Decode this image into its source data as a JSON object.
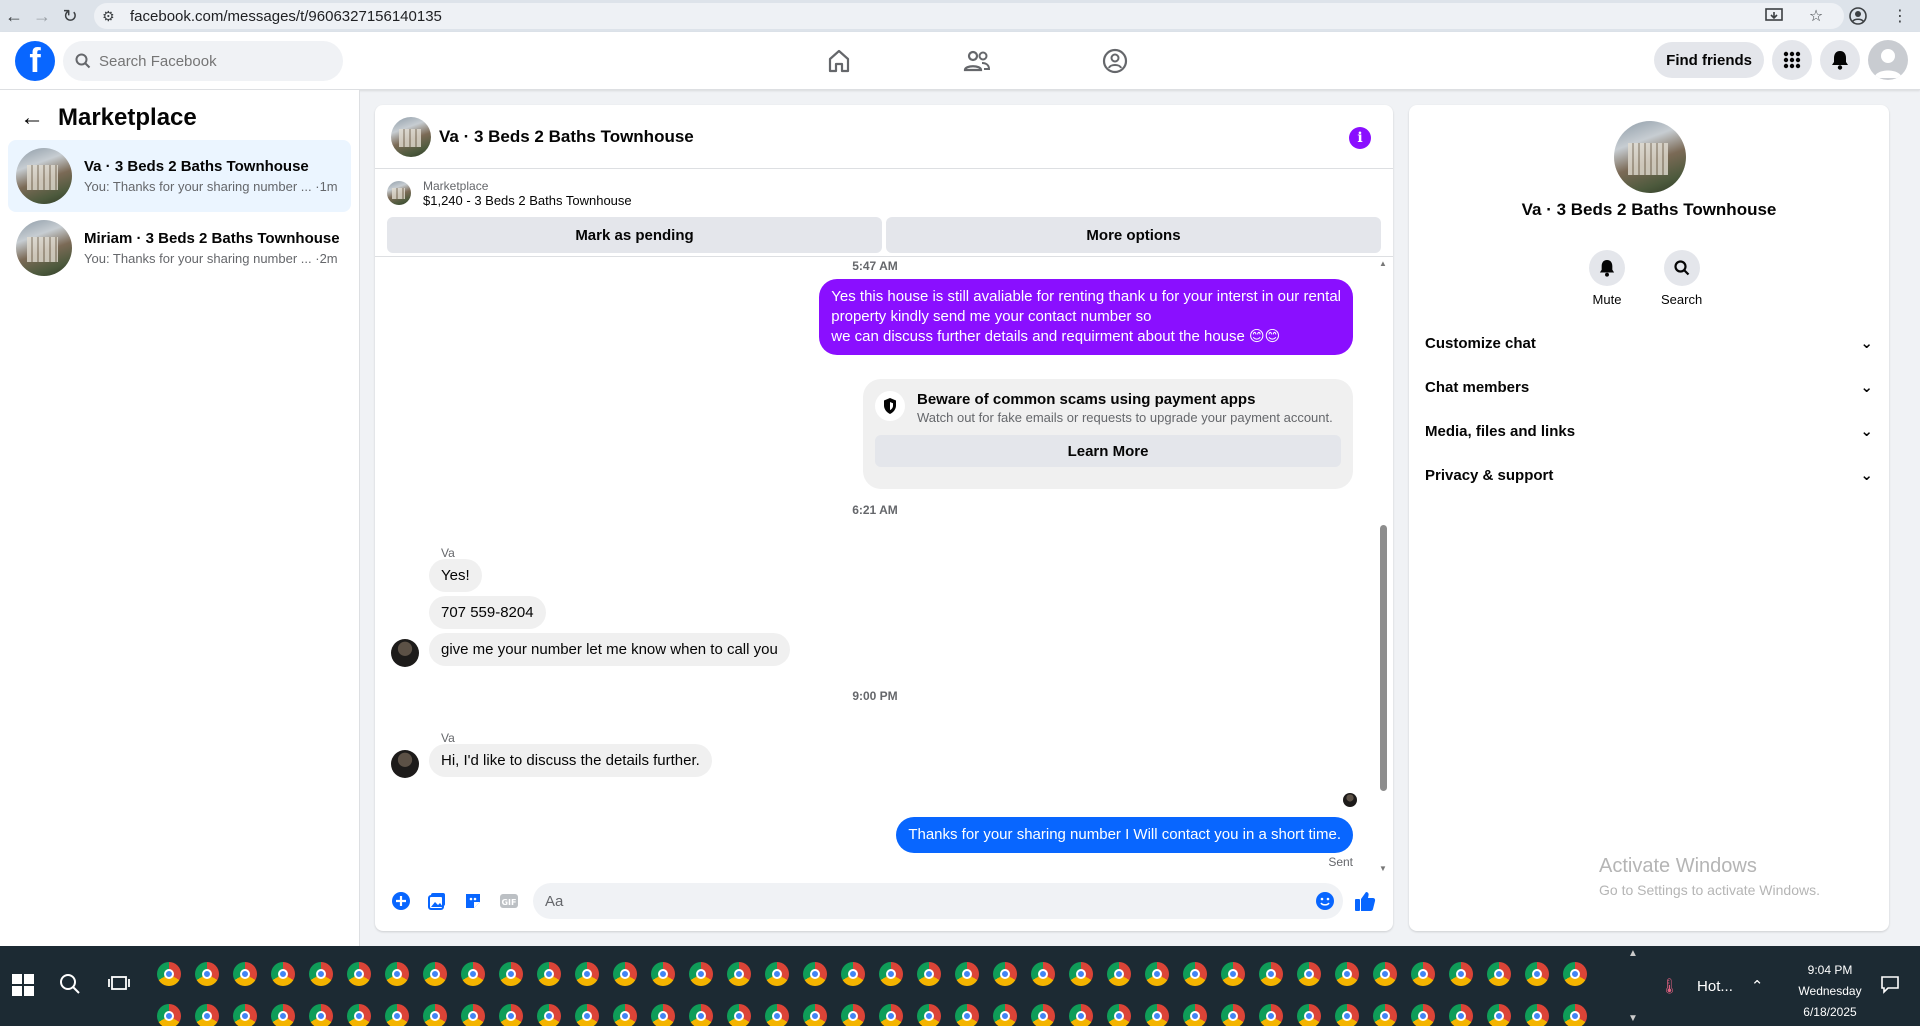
{
  "browser": {
    "url": "facebook.com/messages/t/9606327156140135"
  },
  "topbar": {
    "logo_letter": "f",
    "search_placeholder": "Search Facebook",
    "find_friends_label": "Find friends"
  },
  "sidebar": {
    "title": "Marketplace",
    "chats": [
      {
        "name": "Va · 3 Beds 2 Baths Townhouse",
        "snippet": "You: Thanks for your sharing number ... ·1m"
      },
      {
        "name": "Miriam · 3 Beds 2 Baths Townhouse",
        "snippet": "You: Thanks for your sharing number ... ·2m"
      }
    ]
  },
  "conversation": {
    "title": "Va · 3 Beds 2 Baths Townhouse",
    "info_icon": "i",
    "listing": {
      "label": "Marketplace",
      "price_title": "$1,240 - 3 Beds 2 Baths Townhouse"
    },
    "actions": [
      "Mark as pending",
      "More options"
    ],
    "messages": {
      "time_0": "5:47 AM",
      "out_1_line1": "Yes this house is still avaliable for renting thank u for your interst in our rental",
      "out_1_line2": "property kindly send me your contact number so",
      "out_1_line3": "we can discuss further details and requirment about the house 😊😊",
      "warning_title": "Beware of common scams using payment apps",
      "warning_sub": "Watch out for fake emails or requests to upgrade your payment account.",
      "learn_more": "Learn More",
      "time_1": "6:21 AM",
      "sender_1": "Va",
      "in_1": "Yes!",
      "in_2": "707 559-8204",
      "in_3": "give me your number let me know when to call you",
      "time_2": "9:00 PM",
      "sender_2": "Va",
      "in_4": "Hi, I'd like to discuss the details further.",
      "out_2": "Thanks for your sharing number I Will contact you in a short time.",
      "status": "Sent"
    },
    "composer_placeholder": "Aa"
  },
  "details": {
    "title": "Va · 3 Beds 2 Baths Townhouse",
    "actions": [
      "Mute",
      "Search"
    ],
    "sections": [
      "Customize chat",
      "Chat members",
      "Media, files and links",
      "Privacy & support"
    ],
    "activate_title": "Activate Windows",
    "activate_sub": "Go to Settings to activate Windows."
  },
  "taskbar": {
    "weather": "Hot...",
    "time": "9:04 PM",
    "day": "Wednesday",
    "date": "6/18/2025"
  },
  "colors": {
    "accent_purple": "#8a0fff",
    "messenger_blue": "#0866ff",
    "facebook_blue": "#0866ff"
  }
}
